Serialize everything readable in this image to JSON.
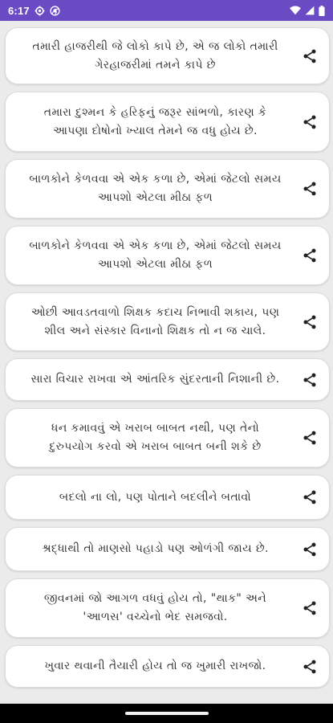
{
  "status_bar": {
    "time": "6:17",
    "icons": [
      "settings-gear-icon",
      "chrome-icon",
      "wifi-icon",
      "signal-icon",
      "battery-icon"
    ],
    "background": "#6a4bc4"
  },
  "quotes": [
    {
      "lines": [
        "તમારી હાજરીથી જે લોકો કાપે છે, એ જ લોકો તમારી",
        "ગેરહાજરીમાં તમને કાપે છે"
      ]
    },
    {
      "lines": [
        "તમારા દુશ્મન કે હરિફનું જરૂર સાંભળો, કારણ કે",
        "આપણા દોષોનો ખ્યાલ તેમને જ વધુ હોય છે."
      ]
    },
    {
      "lines": [
        "બાળકોને કેળવવા એ એક કળા છે, એમાં જેટલો સમય",
        "આપશો એટલા મીઠા ફળ"
      ]
    },
    {
      "lines": [
        "બાળકોને કેળવવા એ એક કળા છે, એમાં જેટલો સમય",
        "આપશો એટલા મીઠા ફળ"
      ]
    },
    {
      "lines": [
        "ઓછી આવડતવાળો શિક્ષક કદાચ નિભાવી શકાય, પણ",
        "શીલ અને સંસ્કાર વિનાનો શિક્ષક તો ન જ ચાલે."
      ]
    },
    {
      "lines": [
        "સારા વિચાર રાખવા એ આંતરિક સુંદરતાની નિશાની છે."
      ]
    },
    {
      "lines": [
        "ધન કમાવવું એ ખરાબ બાબત નથી, પણ તેનો",
        "દુરુપયોગ કરવો એ ખરાબ બાબત બની શકે છે"
      ]
    },
    {
      "lines": [
        "બદલો ના લો, પણ પોતાને બદલીને બતાવો"
      ]
    },
    {
      "lines": [
        "શ્રદ્ધાથી તો માણસો પહાડો પણ ઓળંગી જાય છે."
      ]
    },
    {
      "lines": [
        "જીવનમાં જો આગળ વધવું હોય તો, \"થાક\" અને",
        "'આળસ' વચ્ચેનો ભેદ સમજવો."
      ]
    },
    {
      "lines": [
        "ખુવાર થવાની તૈયારી હોય તો જ ખુમારી રાખજો."
      ]
    }
  ],
  "share_icon": "share-icon",
  "colors": {
    "card": "#ffffff",
    "text": "#333333",
    "background": "#ebebeb"
  }
}
